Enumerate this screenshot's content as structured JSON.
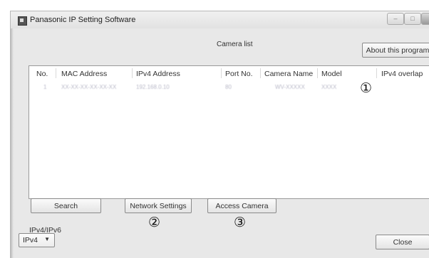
{
  "window": {
    "title": "Panasonic IP Setting Software",
    "controls": [
      {
        "name": "minimize-button",
        "icon": "minimize-icon",
        "glyph": "–"
      },
      {
        "name": "maximize-button",
        "icon": "maximize-icon",
        "glyph": "□"
      },
      {
        "name": "close-button",
        "icon": "close-icon",
        "glyph": ""
      }
    ]
  },
  "header": {
    "caption": "Camera list",
    "about_label": "About this program"
  },
  "table": {
    "columns": [
      "No.",
      "MAC Address",
      "IPv4 Address",
      "Port No.",
      "Camera Name",
      "Model",
      "IPv4 overlap"
    ],
    "rows": [
      [
        "1",
        "XX-XX-XX-XX-XX-XX",
        "192.168.0.10",
        "80",
        "WV-XXXXX",
        "XXXX",
        ""
      ]
    ]
  },
  "markers": {
    "one": "①",
    "two": "②",
    "three": "③"
  },
  "buttons": {
    "search": "Search",
    "network_settings": "Network Settings",
    "access_camera": "Access Camera",
    "close": "Close"
  },
  "ip_mode": {
    "label": "IPv4/IPv6",
    "selected": "IPv4"
  }
}
